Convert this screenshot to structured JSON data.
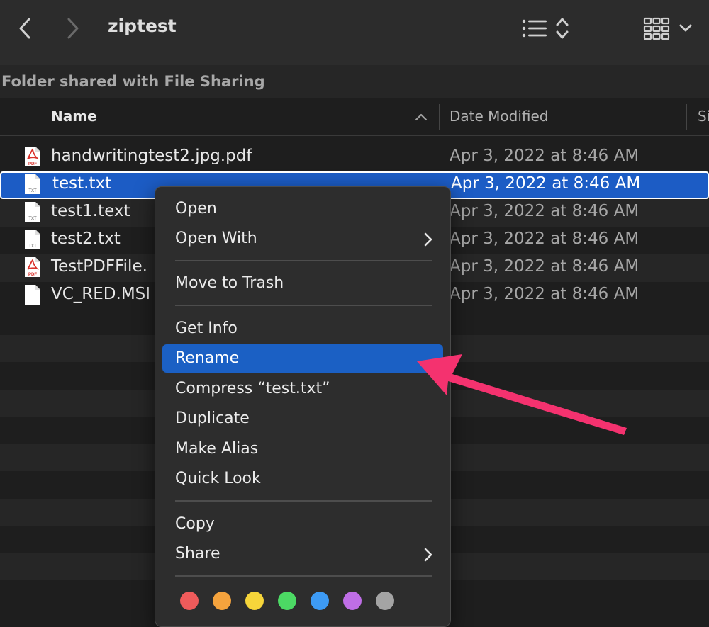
{
  "window": {
    "title": "ziptest",
    "back_icon": "chevron-left-icon",
    "forward_icon": "chevron-right-icon",
    "list_view_icon": "list-icon",
    "sort_icon": "up-down-chevron-icon",
    "group_icon": "icon-grid-icon",
    "group_dropdown_icon": "chevron-down-icon"
  },
  "path_bar": {
    "text": "Folder shared with File Sharing"
  },
  "columns": [
    {
      "label": "Name"
    },
    {
      "label": "Date Modified"
    },
    {
      "label": "Si"
    }
  ],
  "files": [
    {
      "name": "handwritingtest2.jpg.pdf",
      "date": "Apr 3, 2022 at 8:46 AM",
      "icon": "pdf-file-icon",
      "icon_label": "PDF"
    },
    {
      "name": "test.txt",
      "date": "Apr 3, 2022 at 8:46 AM",
      "icon": "txt-file-icon",
      "icon_label": "TXT",
      "selected": true
    },
    {
      "name": "test1.text",
      "date": "Apr 3, 2022 at 8:46 AM",
      "icon": "txt-file-icon",
      "icon_label": "TXT"
    },
    {
      "name": "test2.txt",
      "date": "Apr 3, 2022 at 8:46 AM",
      "icon": "txt-file-icon",
      "icon_label": "TXT"
    },
    {
      "name": "TestPDFFile.",
      "date": "Apr 3, 2022 at 8:46 AM",
      "icon": "pdf-file-icon",
      "icon_label": "PDF"
    },
    {
      "name": "VC_RED.MSI",
      "date": "Apr 3, 2022 at 8:46 AM",
      "icon": "blank-file-icon",
      "icon_label": ""
    }
  ],
  "context_menu": {
    "items": [
      {
        "label": "Open"
      },
      {
        "label": "Open With",
        "submenu": true
      },
      {
        "label": "Move to Trash"
      },
      {
        "label": "Get Info"
      },
      {
        "label": "Rename",
        "highlighted": true
      },
      {
        "label": "Compress “test.txt”"
      },
      {
        "label": "Duplicate"
      },
      {
        "label": "Make Alias"
      },
      {
        "label": "Quick Look"
      },
      {
        "label": "Copy"
      },
      {
        "label": "Share",
        "submenu": true
      }
    ],
    "tag_colors": [
      {
        "name": "red",
        "color": "#ef5b5b"
      },
      {
        "name": "orange",
        "color": "#f5a33d"
      },
      {
        "name": "yellow",
        "color": "#f6d53a"
      },
      {
        "name": "green",
        "color": "#4cd964"
      },
      {
        "name": "blue",
        "color": "#3d9bf5"
      },
      {
        "name": "purple",
        "color": "#bf6ee6"
      },
      {
        "name": "gray",
        "color": "#a4a4a4"
      }
    ]
  },
  "annotation": {
    "arrow_color": "#f4326f",
    "points_to": "Rename"
  },
  "colors": {
    "selection": "#1c5cc5",
    "menu_highlight": "#1b60c4",
    "pdf_red": "#d9312b"
  }
}
